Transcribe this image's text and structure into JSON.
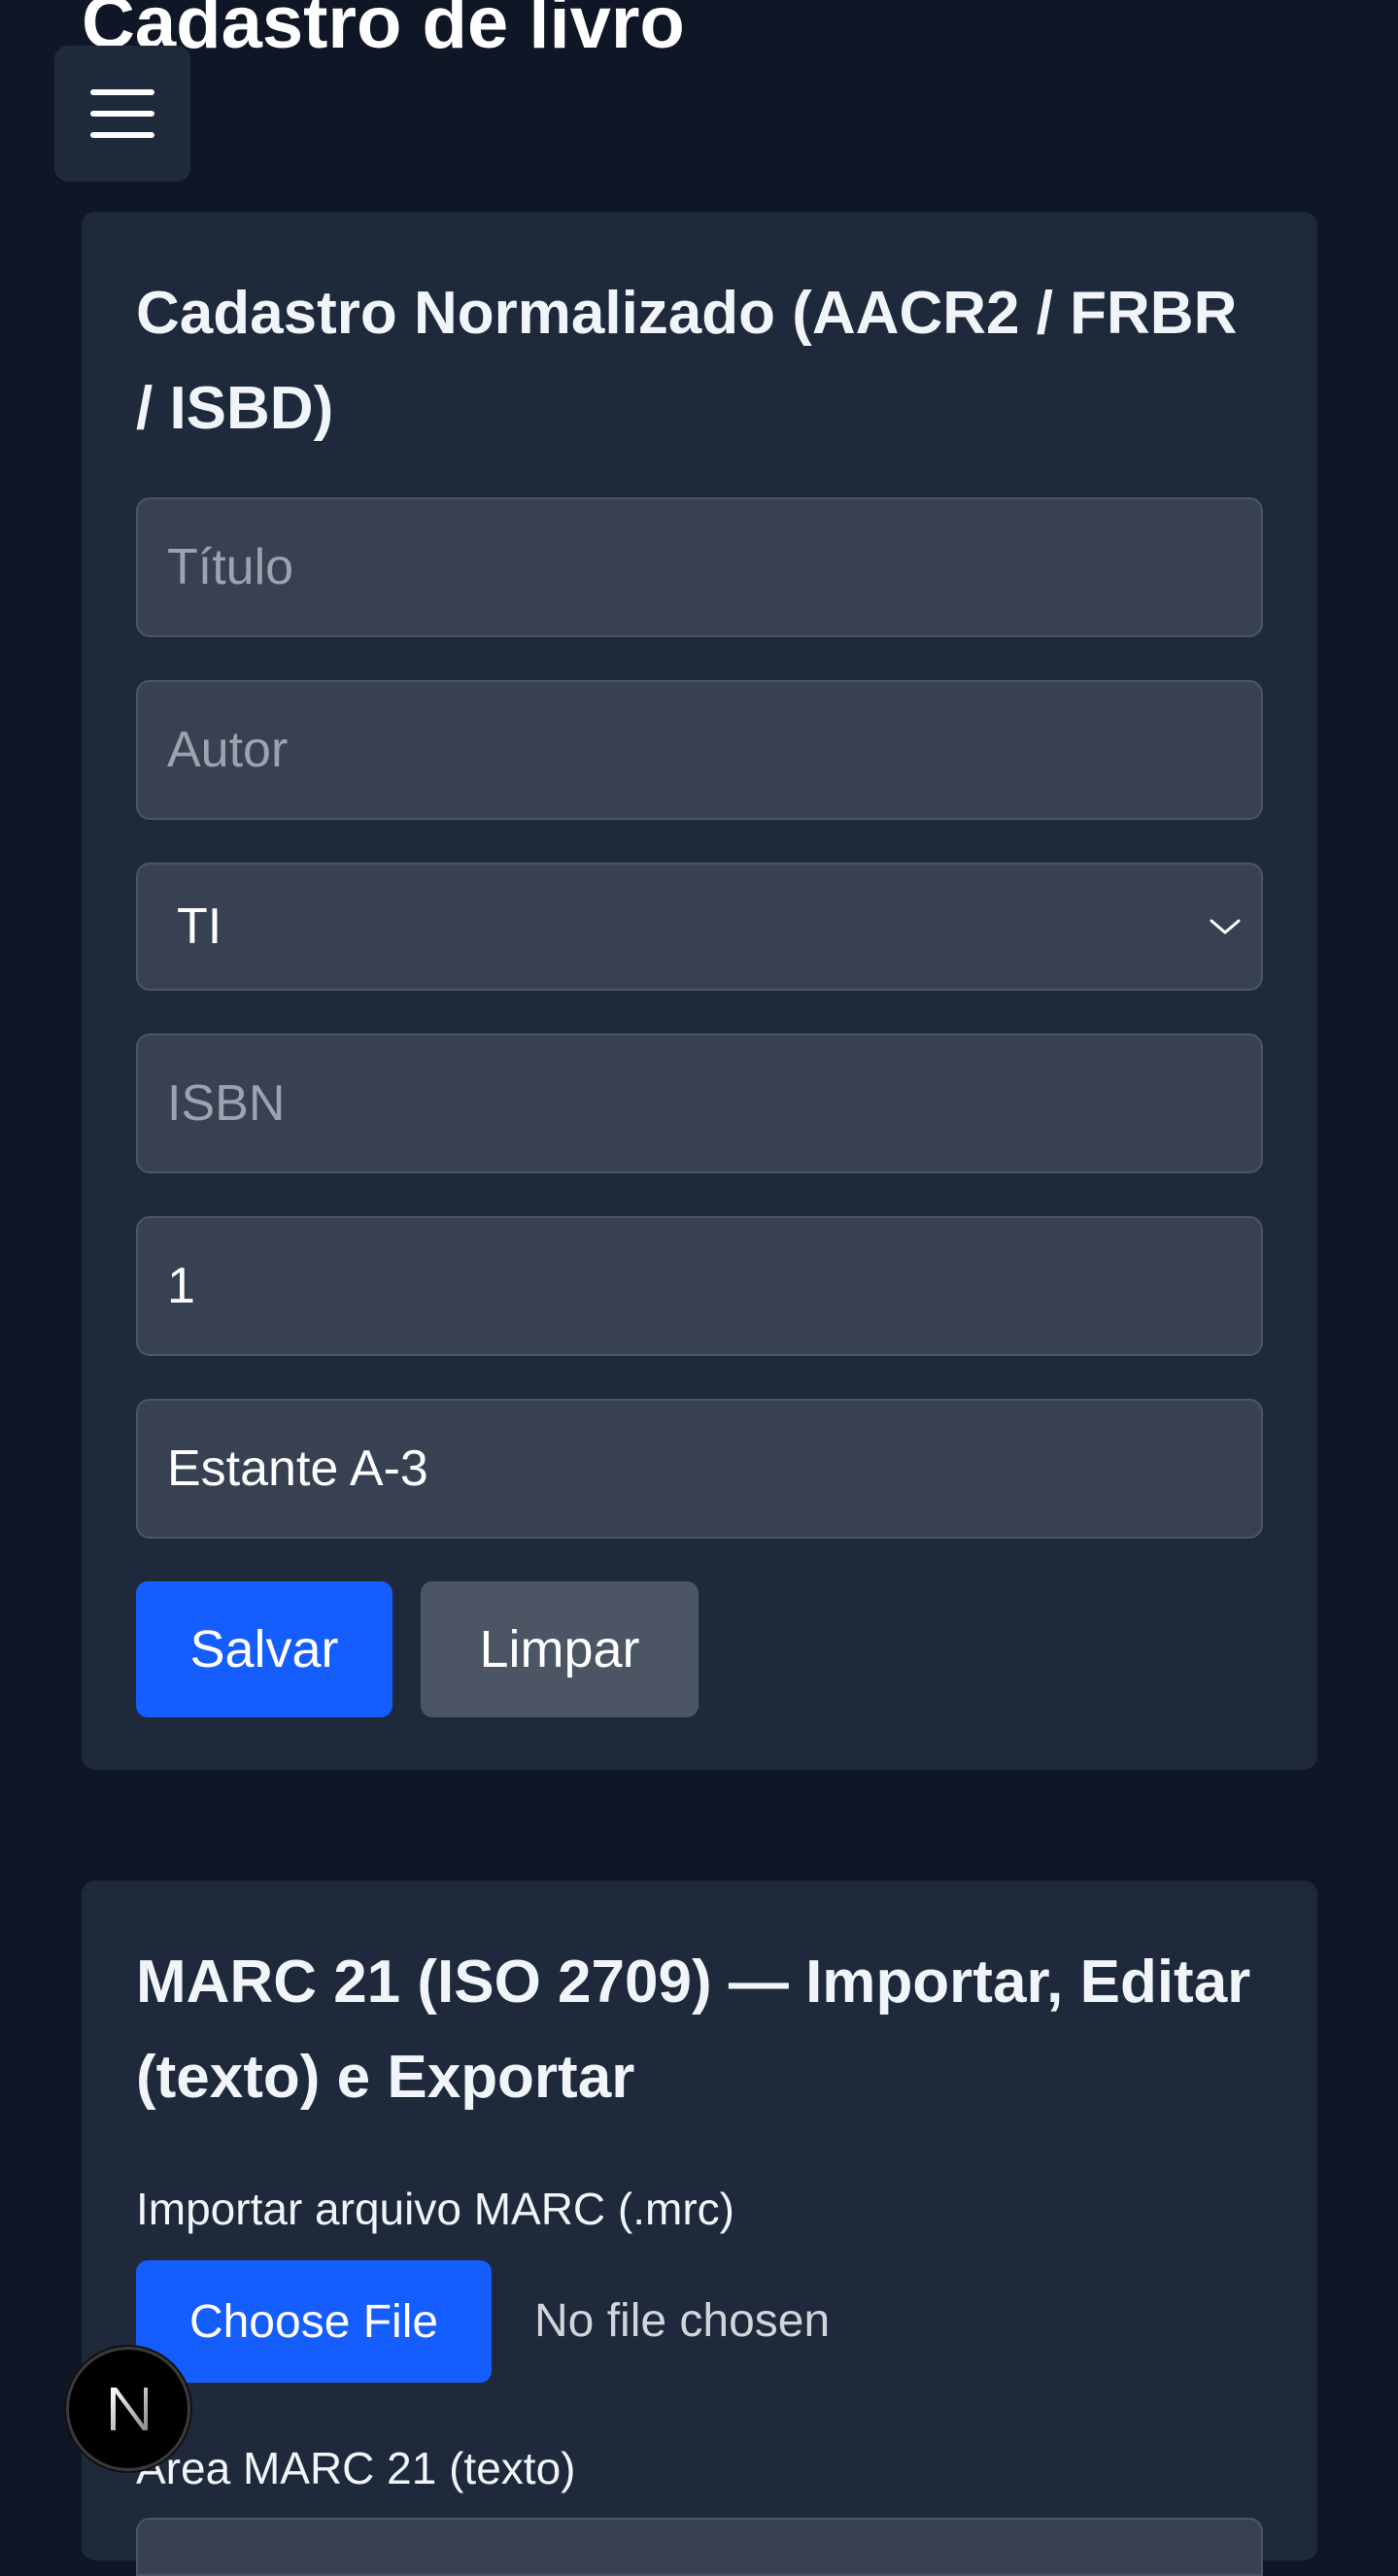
{
  "page": {
    "title": "Cadastro de livro"
  },
  "header": {
    "menu_icon": "hamburger-menu-icon"
  },
  "normalized_form": {
    "heading": "Cadastro Normalizado (AACR2 / FRBR / ISBD)",
    "title_placeholder": "Título",
    "author_placeholder": "Autor",
    "category_selected": "TI",
    "isbn_placeholder": "ISBN",
    "quantity_value": "1",
    "location_value": "Estante A-3",
    "save_label": "Salvar",
    "clear_label": "Limpar"
  },
  "marc_section": {
    "heading": "MARC 21 (ISO 2709) — Importar, Editar (texto) e Exportar",
    "import_label": "Importar arquivo MARC (.mrc)",
    "choose_file_label": "Choose File",
    "file_status": "No file chosen",
    "text_area_label": "Área MARC 21 (texto)"
  },
  "framework_badge": {
    "letter": "N",
    "icon": "nextjs-logo-icon"
  },
  "colors": {
    "background": "#0f1726",
    "card": "#1e293b",
    "input": "#374151",
    "primary": "#155dfc",
    "secondary_button": "#4b5563"
  }
}
